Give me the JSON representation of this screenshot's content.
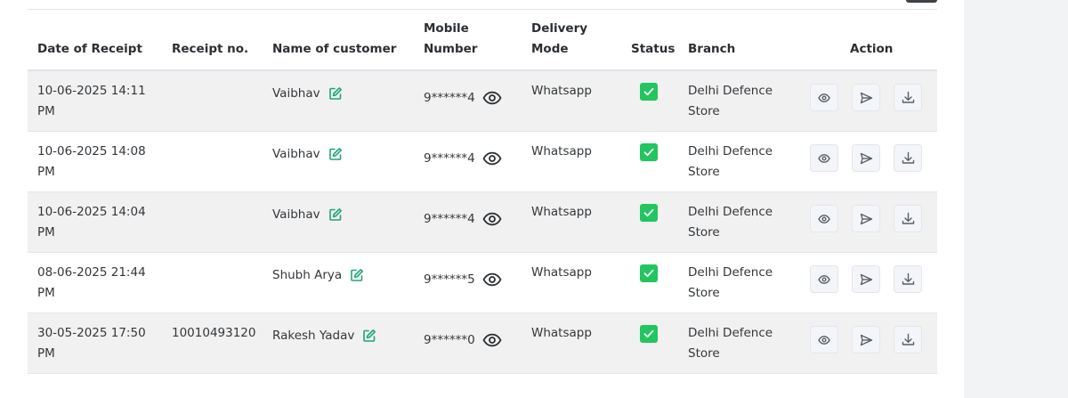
{
  "table": {
    "headers": {
      "date": "Date of Receipt",
      "receipt": "Receipt no.",
      "name": "Name of customer",
      "mobile_line1": "Mobile",
      "mobile_line2": "Number",
      "mode_line1": "Delivery",
      "mode_line2": "Mode",
      "status": "Status",
      "branch": "Branch",
      "action": "Action"
    },
    "rows": [
      {
        "date_line1": "10-06-2025 14:11",
        "date_line2": "PM",
        "receipt": "",
        "name": "Vaibhav",
        "mobile": "9******4",
        "mode": "Whatsapp",
        "branch_line1": "Delhi Defence",
        "branch_line2": "Store"
      },
      {
        "date_line1": "10-06-2025 14:08",
        "date_line2": "PM",
        "receipt": "",
        "name": "Vaibhav",
        "mobile": "9******4",
        "mode": "Whatsapp",
        "branch_line1": "Delhi Defence",
        "branch_line2": "Store"
      },
      {
        "date_line1": "10-06-2025 14:04",
        "date_line2": "PM",
        "receipt": "",
        "name": "Vaibhav",
        "mobile": "9******4",
        "mode": "Whatsapp",
        "branch_line1": "Delhi Defence",
        "branch_line2": "Store"
      },
      {
        "date_line1": "08-06-2025 21:44",
        "date_line2": "PM",
        "receipt": "",
        "name": "Shubh Arya",
        "mobile": "9******5",
        "mode": "Whatsapp",
        "branch_line1": "Delhi Defence",
        "branch_line2": "Store"
      },
      {
        "date_line1": "30-05-2025 17:50",
        "date_line2": "PM",
        "receipt": "10010493120",
        "name": "Rakesh Yadav",
        "mobile": "9******0",
        "mode": "Whatsapp",
        "branch_line1": "Delhi Defence",
        "branch_line2": "Store"
      }
    ]
  },
  "icons": {
    "edit": "edit-icon",
    "reveal": "eye-icon",
    "status": "checkbox-checked-icon",
    "view": "eye-icon",
    "send": "send-icon",
    "download": "download-icon"
  },
  "colors": {
    "edit_icon": "#1ea672",
    "status_check": "#22c55e",
    "odd_row": "#f1f1f1"
  }
}
